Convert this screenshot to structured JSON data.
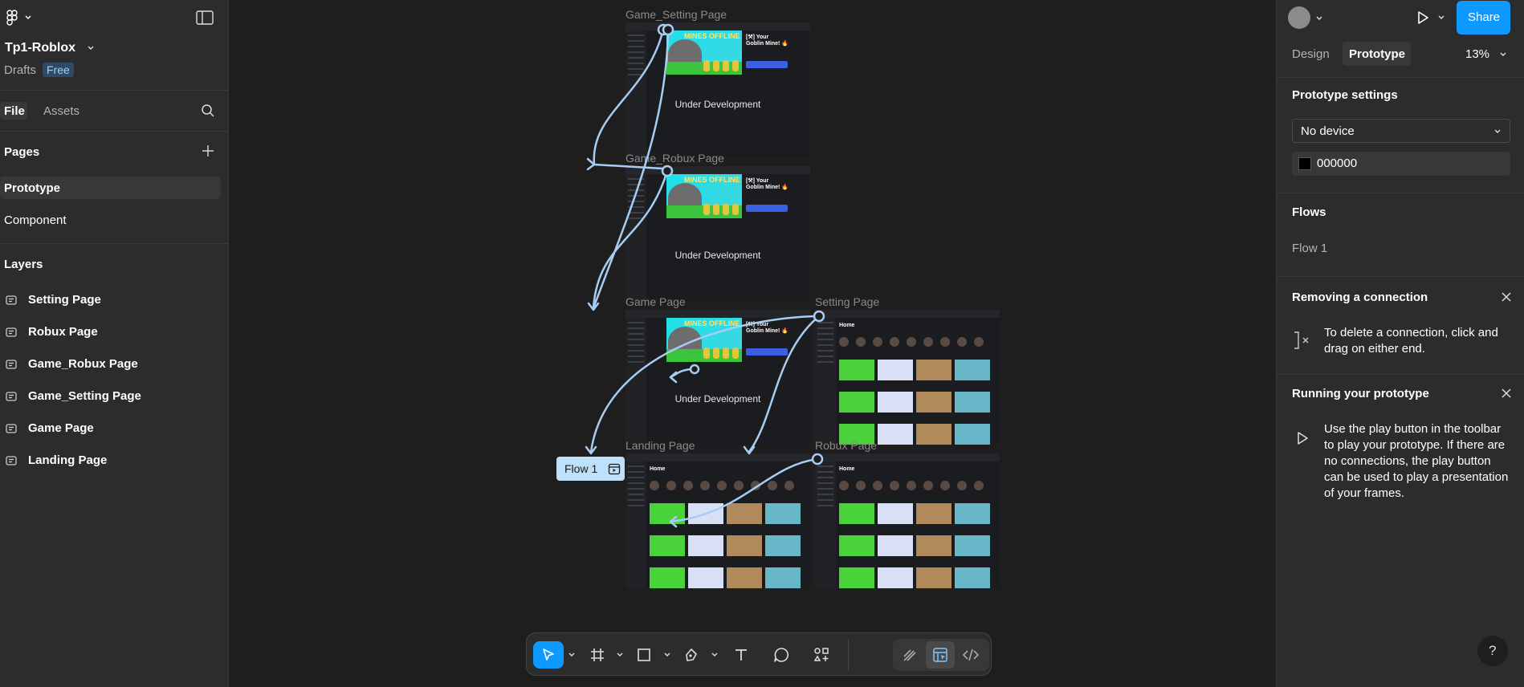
{
  "file": {
    "name": "Tp1-Roblox",
    "location": "Drafts",
    "plan": "Free"
  },
  "left_tabs": {
    "file": "File",
    "assets": "Assets"
  },
  "pages": {
    "title": "Pages",
    "items": [
      "Prototype",
      "Component"
    ]
  },
  "layers": {
    "title": "Layers",
    "items": [
      "Setting Page",
      "Robux Page",
      "Game_Robux Page",
      "Game_Setting Page",
      "Game Page",
      "Landing Page"
    ]
  },
  "canvas": {
    "frames": {
      "game_setting": "Game_Setting Page",
      "game_robux": "Game_Robux Page",
      "game": "Game Page",
      "setting": "Setting Page",
      "landing": "Landing Page",
      "robux": "Robux Page"
    },
    "frame_text": {
      "under_development": "Under Development",
      "game_title_1": "[⚒] Your",
      "game_title_2": "Goblin Mine! 🔥",
      "banner_title": "MINES OFFLINE",
      "home": "Home"
    },
    "flow_tag": "Flow 1"
  },
  "right_tabs": {
    "design": "Design",
    "prototype": "Prototype",
    "zoom": "13%"
  },
  "share_label": "Share",
  "prototype_settings": {
    "title": "Prototype settings",
    "device": "No device",
    "bg_color_hex": "000000",
    "bg_color": "#000000"
  },
  "flows": {
    "title": "Flows",
    "items": [
      "Flow 1"
    ]
  },
  "tips": {
    "removing": {
      "title": "Removing a connection",
      "body": "To delete a connection, click and drag on either end."
    },
    "running": {
      "title": "Running your prototype",
      "body": "Use the play button in the toolbar to play your prototype. If there are no connections, the play button can be used to play a presentation of your frames."
    }
  },
  "help_label": "?",
  "colors": {
    "accent": "#0d99ff",
    "connection": "#a8cdf2",
    "panel": "#2c2c2c",
    "canvas": "#1e1e1e"
  }
}
